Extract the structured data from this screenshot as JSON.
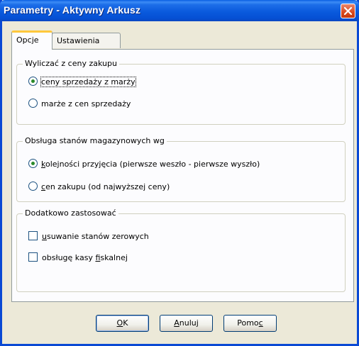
{
  "window": {
    "title": "Parametry - Aktywny Arkusz"
  },
  "tabs": [
    {
      "label": "Opcje"
    },
    {
      "label": "Ustawienia"
    }
  ],
  "group_price": {
    "label": "Wyliczać z ceny zakupu",
    "options": [
      {
        "label": "ceny sprzedaży z marży",
        "checked": true
      },
      {
        "label": "marże z cen sprzedaży",
        "checked": false
      }
    ]
  },
  "group_stock": {
    "label": "Obsługa stanów magazynowych wg",
    "options": [
      {
        "label_u": "k",
        "label_rest": "olejności przyjęcia (pierwsze weszło - pierwsze wyszło)",
        "checked": true
      },
      {
        "label_u": "c",
        "label_rest": "en zakupu (od najwyższej ceny)",
        "checked": false
      }
    ]
  },
  "group_extra": {
    "label": "Dodatkowo zastosować",
    "options": [
      {
        "label_pre": "",
        "label_u": "u",
        "label_rest": "suwanie stanów zerowych",
        "checked": false
      },
      {
        "label_pre": "obsługę kasy ",
        "label_u": "f",
        "label_rest": "iskalnej",
        "checked": false
      }
    ]
  },
  "buttons": {
    "ok": {
      "u": "O",
      "rest": "K"
    },
    "cancel": {
      "u": "A",
      "rest": "nuluj"
    },
    "help": {
      "pre": "Pomo",
      "u": "c"
    }
  }
}
